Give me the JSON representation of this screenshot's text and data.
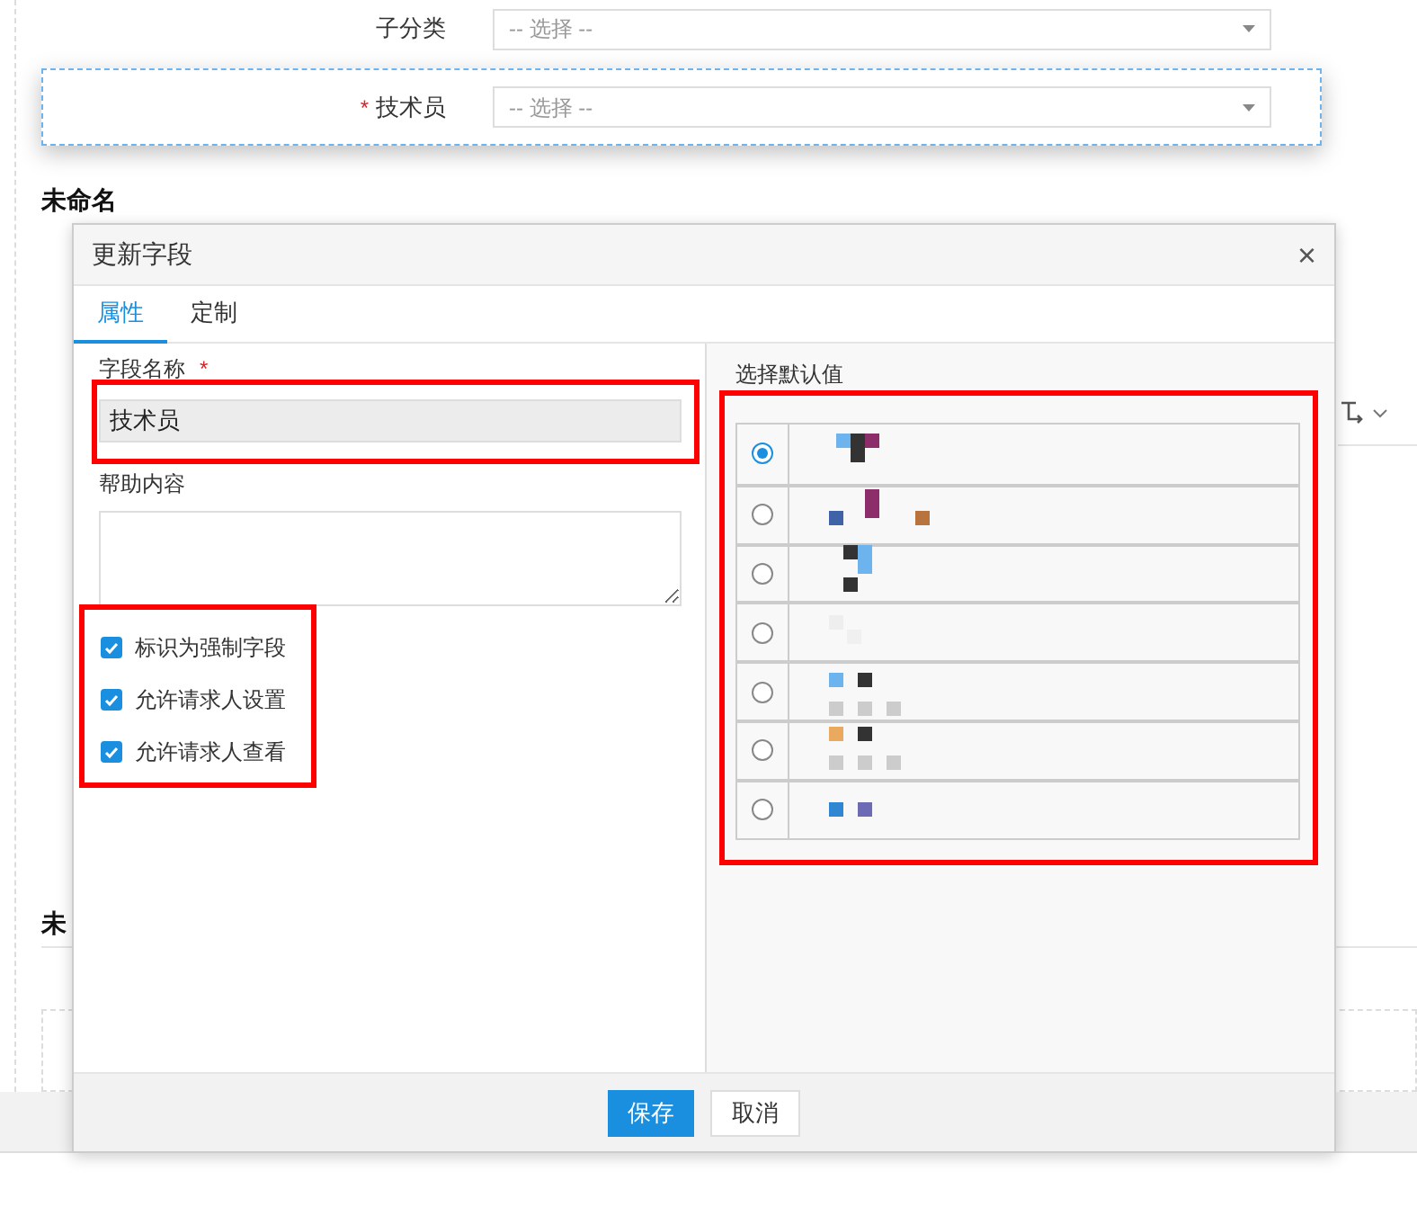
{
  "form": {
    "rows": [
      {
        "label": "子分类",
        "placeholder": "-- 选择 --",
        "focused": false
      },
      {
        "label": "技术员",
        "required_mark": "*",
        "placeholder": "-- 选择 --",
        "focused": true
      }
    ],
    "sections": [
      "未命名",
      "未"
    ]
  },
  "dialog": {
    "title": "更新字段",
    "close": "×",
    "tabs": [
      {
        "label": "属性",
        "selected": true
      },
      {
        "label": "定制",
        "selected": false
      }
    ],
    "field_name": {
      "label": "字段名称",
      "required_mark": "*",
      "value": "技术员"
    },
    "help": {
      "label": "帮助内容"
    },
    "checkboxes": [
      {
        "label": "标识为强制字段",
        "checked": true
      },
      {
        "label": "允许请求人设置",
        "checked": true
      },
      {
        "label": "允许请求人查看",
        "checked": true
      }
    ],
    "default_value": {
      "label": "选择默认值",
      "options": [
        {
          "selected": true
        },
        {
          "selected": false
        },
        {
          "selected": false
        },
        {
          "selected": false
        },
        {
          "selected": false
        },
        {
          "selected": false
        },
        {
          "selected": false
        }
      ]
    },
    "buttons": [
      {
        "label": "保存",
        "kind": "primary"
      },
      {
        "label": "取消",
        "kind": "secondary"
      }
    ]
  }
}
